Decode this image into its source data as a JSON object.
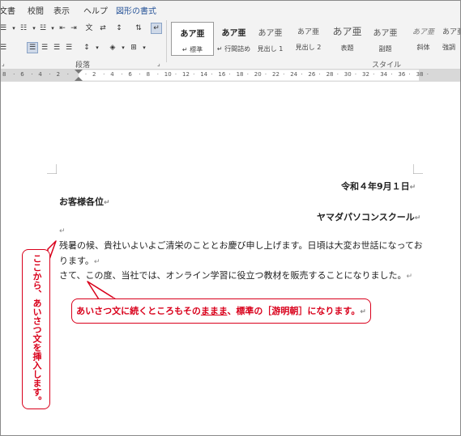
{
  "tabs": [
    {
      "label": "文書",
      "active": false
    },
    {
      "label": "校閲",
      "active": false
    },
    {
      "label": "表示",
      "active": false
    },
    {
      "label": "ヘルプ",
      "active": false
    },
    {
      "label": "図形の書式",
      "active": true
    }
  ],
  "ribbon": {
    "paragraph_group_label": "段落",
    "style_group_label": "スタイル",
    "styles": [
      {
        "preview": "あア亜",
        "name": "↵ 標準",
        "selected": true
      },
      {
        "preview": "あア亜",
        "name": "↵ 行間詰め",
        "selected": false
      },
      {
        "preview": "あア亜",
        "name": "見出し 1",
        "selected": false
      },
      {
        "preview": "あア亜",
        "name": "見出し 2",
        "selected": false
      },
      {
        "preview": "あア亜",
        "name": "表題",
        "selected": false
      },
      {
        "preview": "あア亜",
        "name": "副題",
        "selected": false
      },
      {
        "preview": "あア亜",
        "name": "斜体",
        "selected": false
      },
      {
        "preview": "あア亜",
        "name": "強調",
        "selected": false
      }
    ]
  },
  "ruler": {
    "numbers": [
      "8",
      "6",
      "4",
      "2",
      "",
      "2",
      "4",
      "6",
      "8",
      "10",
      "12",
      "14",
      "16",
      "18",
      "20",
      "22",
      "24",
      "26",
      "28",
      "30",
      "32",
      "34",
      "36",
      "38"
    ]
  },
  "document": {
    "date": "令和４年9月１日",
    "recipient": "お客様各位",
    "sender": "ヤマダパソコンスクール",
    "body_line1": "残暑の候、貴社いよいよご清栄のこととお慶び申し上げます。日頃は大変お世話になってお",
    "body_line2": "ります。",
    "body_line3": "さて、この度、当社では、オンライン学習に役立つ教材を販売することになりました。",
    "para_mark": "↵"
  },
  "callouts": {
    "horizontal_pre": "あいさつ文に続くところもその",
    "horizontal_underlined": "ままま",
    "horizontal_post": "、標準の［游明朝］になります。",
    "vertical": "ここから、あいさつ文を挿入します。"
  },
  "colors": {
    "callout_red": "#d9001b",
    "active_tab_blue": "#2b579a"
  }
}
